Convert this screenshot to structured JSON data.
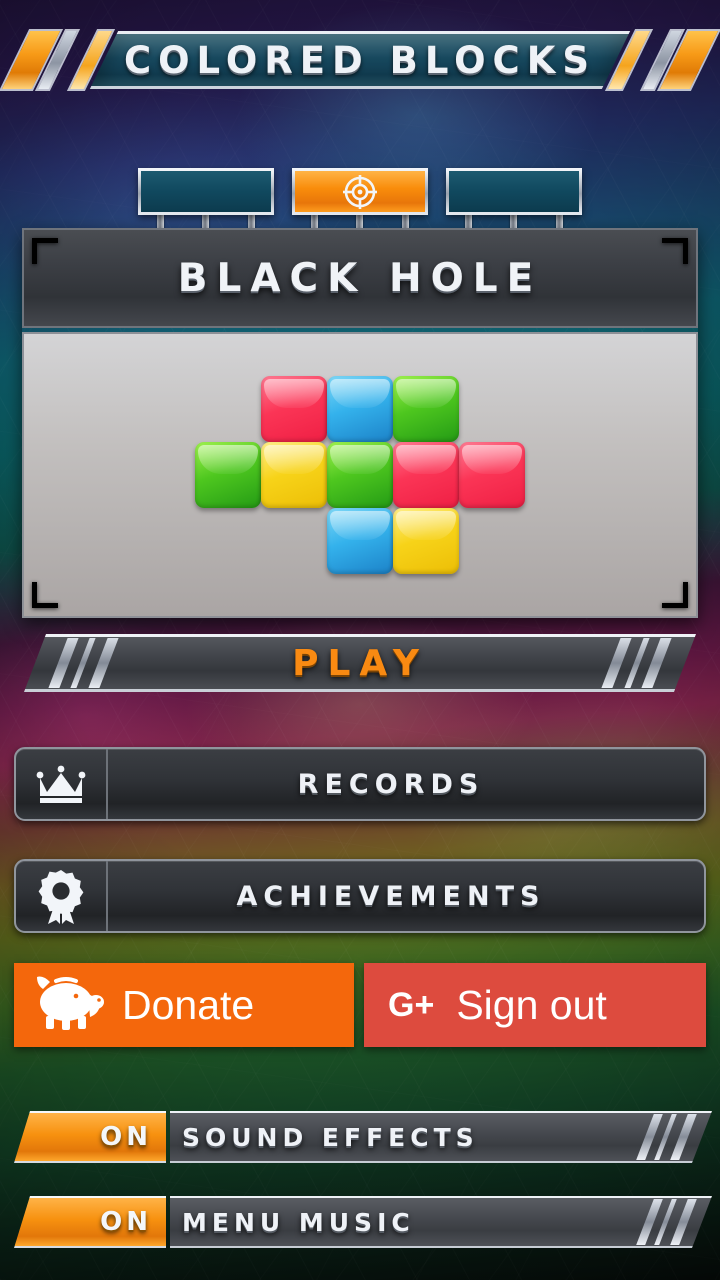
{
  "app": {
    "title": "COLORED BLOCKS",
    "accent_orange": "#f7910f",
    "accent_red": "#dd4b3e",
    "panel_dark": "#303338"
  },
  "tabs": [
    {
      "name": "tab-left",
      "icon": "",
      "active": false
    },
    {
      "name": "tab-center",
      "icon": "crosshair-icon",
      "active": true
    },
    {
      "name": "tab-right",
      "icon": "",
      "active": false
    }
  ],
  "level_panel": {
    "title": "BLACK HOLE",
    "preview": {
      "type": "block-grid",
      "cell_size": 66,
      "blocks": [
        {
          "row": 0,
          "col": 1,
          "color": "red"
        },
        {
          "row": 0,
          "col": 2,
          "color": "blue"
        },
        {
          "row": 0,
          "col": 3,
          "color": "green"
        },
        {
          "row": 1,
          "col": 0,
          "color": "green"
        },
        {
          "row": 1,
          "col": 1,
          "color": "yellow"
        },
        {
          "row": 1,
          "col": 2,
          "color": "green"
        },
        {
          "row": 1,
          "col": 3,
          "color": "red"
        },
        {
          "row": 1,
          "col": 4,
          "color": "red"
        },
        {
          "row": 2,
          "col": 2,
          "color": "blue"
        },
        {
          "row": 2,
          "col": 3,
          "color": "yellow"
        }
      ]
    }
  },
  "play": {
    "label": "PLAY"
  },
  "menu": [
    {
      "key": "records",
      "label": "RECORDS",
      "icon": "crown-icon"
    },
    {
      "key": "achievements",
      "label": "ACHIEVEMENTS",
      "icon": "medal-icon"
    }
  ],
  "account": {
    "donate_label": "Donate",
    "donate_icon": "piggy-bank-icon",
    "signout_label": "Sign out",
    "signout_icon": "google-plus-icon",
    "gplus_text": "G+"
  },
  "settings": [
    {
      "key": "sound_effects",
      "label": "SOUND EFFECTS",
      "state": "ON"
    },
    {
      "key": "menu_music",
      "label": "MENU MUSIC",
      "state": "ON"
    }
  ]
}
